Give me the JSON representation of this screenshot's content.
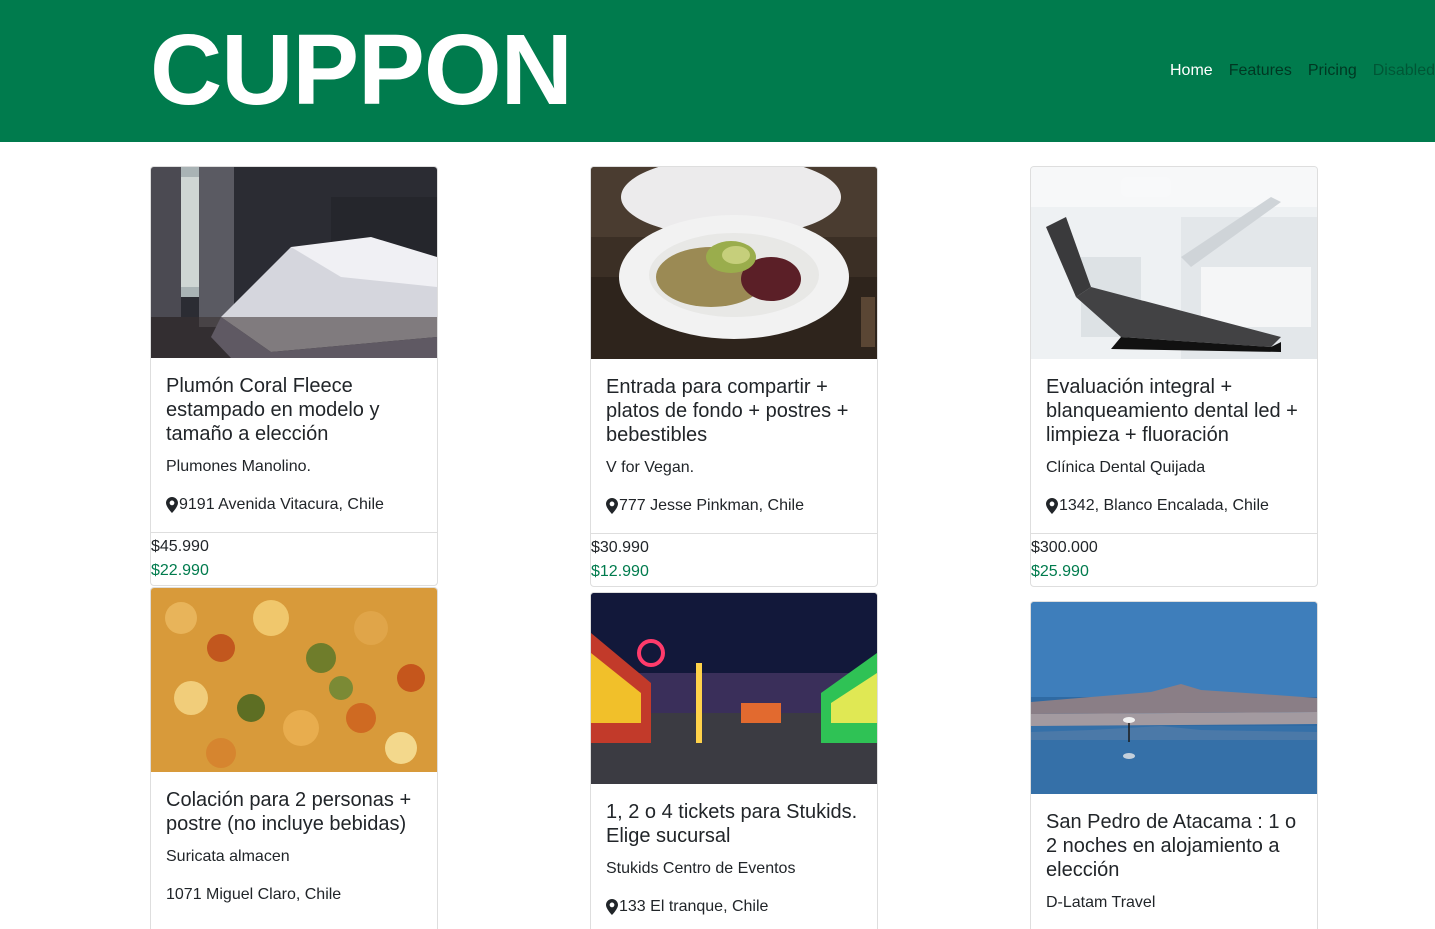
{
  "header": {
    "brand": "CUPPON",
    "nav": [
      {
        "label": "Home",
        "state": "active"
      },
      {
        "label": "Features",
        "state": "normal"
      },
      {
        "label": "Pricing",
        "state": "normal"
      },
      {
        "label": "Disabled",
        "state": "disabled"
      }
    ],
    "color": "#007b4d"
  },
  "cards": [
    {
      "image": "bedroom-photo",
      "title": "Plumón Coral Fleece estampado en modelo y tamaño a elección",
      "merchant": "Plumones Manolino.",
      "location": "9191 Avenida Vitacura, Chile",
      "price_old": "$45.990",
      "price_new": "$22.990"
    },
    {
      "image": "vegan-dish-photo",
      "title": "Entrada para compartir + platos de fondo + postres + bebestibles",
      "merchant": "V for Vegan.",
      "location": "777 Jesse Pinkman, Chile",
      "price_old": "$30.990",
      "price_new": "$12.990"
    },
    {
      "image": "dental-chair-photo",
      "title": "Evaluación integral + blanqueamiento dental led + limpieza + fluoración",
      "merchant": "Clínica Dental Quijada",
      "location": "1342, Blanco Encalada, Chile",
      "price_old": "$300.000",
      "price_new": "$25.990"
    },
    {
      "image": "food-closeup-photo",
      "title": "Colación para 2 personas + postre (no incluye bebidas)",
      "merchant": "Suricata almacen",
      "location": "1071 Miguel Claro, Chile"
    },
    {
      "image": "fair-night-photo",
      "title": "1, 2 o 4 tickets para Stukids. Elige sucursal",
      "merchant": "Stukids Centro de Eventos",
      "location": "133 El tranque, Chile"
    },
    {
      "image": "atacama-lagoon-photo",
      "title": "San Pedro de Atacama : 1 o 2 noches en alojamiento a elección",
      "merchant": "D-Latam Travel"
    }
  ]
}
